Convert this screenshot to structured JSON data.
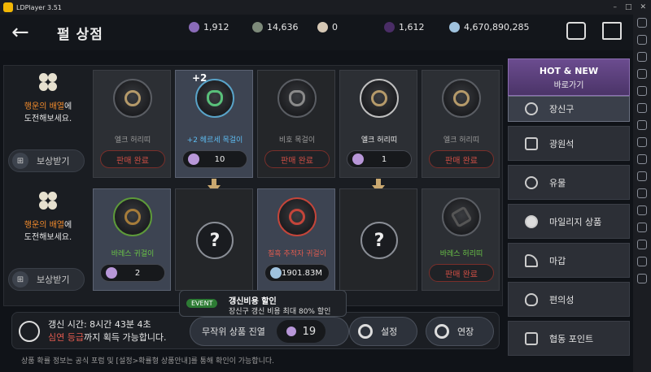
{
  "window": {
    "title": "LDPlayer 3.51"
  },
  "header": {
    "back_label": "←",
    "title": "펄 상점"
  },
  "currencies": [
    {
      "icon": "mileage-coin-icon",
      "value": "1,912",
      "color": "#8a6bb8"
    },
    {
      "icon": "silver-ore-icon",
      "value": "14,636",
      "color": "#7d8a7a"
    },
    {
      "icon": "pearl-icon",
      "value": "0",
      "color": "#d6c8b5"
    },
    {
      "icon": "dark-pearl-icon",
      "value": "1,612",
      "color": "#4a2d66"
    },
    {
      "icon": "silver-icon",
      "value": "4,670,890,285",
      "color": "#9fc2de"
    }
  ],
  "rows": [
    {
      "label_hl": "행운의 배열",
      "label_rest": "에",
      "label_line2": "도전해보세요.",
      "claim_label": "보상받기",
      "cards": [
        {
          "name": "엘크 허리띠",
          "status": "판매 완료"
        },
        {
          "name": "+2 헤르세 목걸이",
          "price": "10",
          "plus": "+2"
        },
        {
          "name": "비호 목걸이",
          "status": "판매 완료"
        },
        {
          "name": "엘크 허리띠",
          "price": "1"
        },
        {
          "name": "엘크 허리띠",
          "status": "판매 완료"
        }
      ]
    },
    {
      "label_hl": "행운의 배열",
      "label_rest": "에",
      "label_line2": "도전해보세요.",
      "claim_label": "보상받기",
      "cards": [
        {
          "name": "바레스 귀걸이",
          "price": "2"
        },
        {
          "question": "?"
        },
        {
          "name": "칠흑 추적자 귀걸이",
          "price": "1901.83M"
        },
        {
          "question": "?"
        },
        {
          "name": "바레스 허리띠",
          "status": "판매 완료"
        }
      ]
    }
  ],
  "bottom": {
    "renew_prefix": "갱신 시간: 8시간 43분 4초",
    "renew_red": "심연 등급",
    "renew_suffix": "까지 획득 가능합니다.",
    "random_label": "무작위 상품 진열",
    "random_cost": "19",
    "settings_label": "설정",
    "extend_label": "연장"
  },
  "event": {
    "tag": "EVENT",
    "title": "갱신비용 할인",
    "desc": "장신구 갱신 비용 최대 80% 할인"
  },
  "footer_note": "상품 확률 정보는 공식 포럼 및 [설정>확률형 상품안내]를 통해 확인이 가능합니다.",
  "sidebar": {
    "hot_title": "HOT & NEW",
    "hot_sub": "바로가기",
    "categories": [
      {
        "label": "장신구",
        "icon": "accessory-icon"
      },
      {
        "label": "광원석",
        "icon": "crystal-icon"
      },
      {
        "label": "유물",
        "icon": "relic-icon"
      },
      {
        "label": "마일리지 상품",
        "icon": "mileage-icon"
      },
      {
        "label": "마갑",
        "icon": "horse-armor-icon"
      },
      {
        "label": "편의성",
        "icon": "potion-icon"
      },
      {
        "label": "협동 포인트",
        "icon": "handshake-icon"
      }
    ]
  }
}
